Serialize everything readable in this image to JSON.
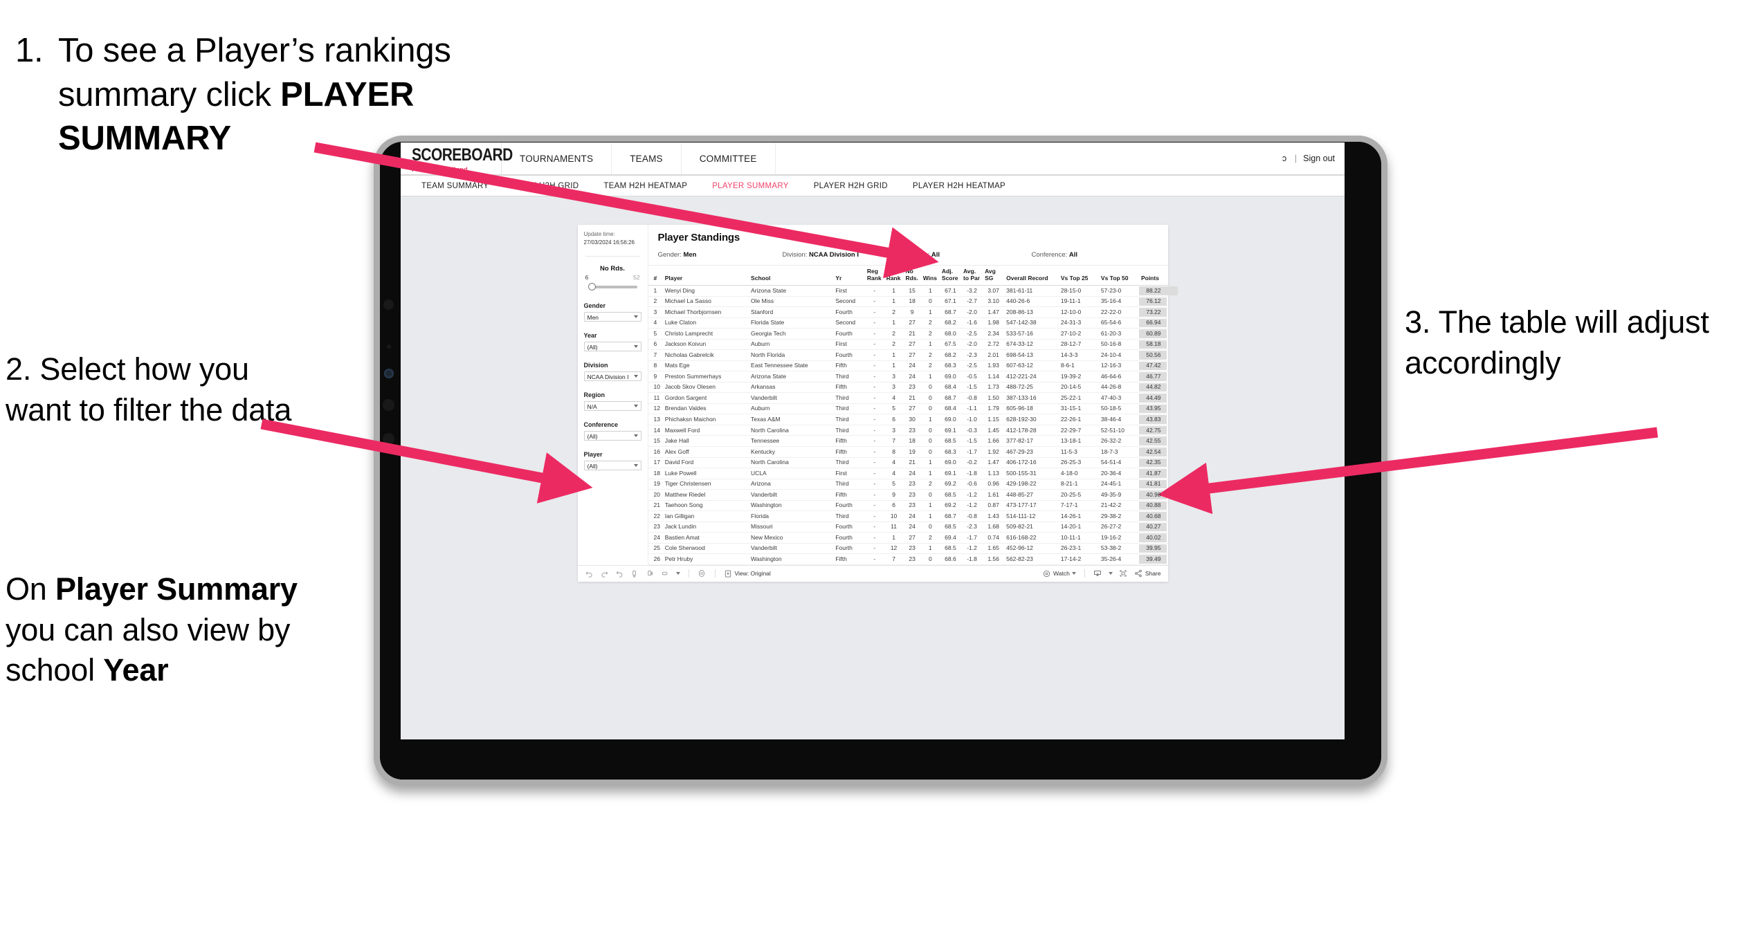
{
  "annotations": {
    "step1_num": "1.",
    "step1_a": "To see a Player’s rankings",
    "step1_b_pre": "summary click ",
    "step1_b_bold": "PLAYER",
    "step1_c_bold": "SUMMARY",
    "step2": "2. Select how you want to filter the data",
    "step2b_pre": "On ",
    "step2b_bold1": "Player Summary",
    "step2b_mid": " you can also view by school ",
    "step2b_bold2": "Year",
    "step3": "3. The table will adjust accordingly"
  },
  "app": {
    "brand_title": "SCOREBOARD",
    "brand_sub_pre": "Powered by ",
    "brand_sub_name": "clippd",
    "top_nav": [
      "TOURNAMENTS",
      "TEAMS",
      "COMMITTEE"
    ],
    "user_clipped": "ɔ",
    "separator": "|",
    "sign_out": "Sign out",
    "tabs": [
      {
        "label": "TEAM SUMMARY",
        "active": false
      },
      {
        "label": "TEAM H2H GRID",
        "active": false
      },
      {
        "label": "TEAM H2H HEATMAP",
        "active": false
      },
      {
        "label": "PLAYER SUMMARY",
        "active": true
      },
      {
        "label": "PLAYER H2H GRID",
        "active": false
      },
      {
        "label": "PLAYER H2H HEATMAP",
        "active": false
      }
    ],
    "accent_color": "#f0436b"
  },
  "viz": {
    "update_label": "Update time:",
    "update_time": "27/03/2024 16:56:26",
    "no_rds_label": "No Rds.",
    "slider_min": "6",
    "slider_max": "52",
    "filters": [
      {
        "label": "Gender",
        "value": "Men"
      },
      {
        "label": "Year",
        "value": "(All)"
      },
      {
        "label": "Division",
        "value": "NCAA Division I"
      },
      {
        "label": "Region",
        "value": "N/A"
      },
      {
        "label": "Conference",
        "value": "(All)"
      },
      {
        "label": "Player",
        "value": "(All)"
      }
    ],
    "title": "Player Standings",
    "meta": [
      {
        "label": "Gender:",
        "value": "Men"
      },
      {
        "label": "Division:",
        "value": "NCAA Division I"
      },
      {
        "label": "Region:",
        "value": "All"
      },
      {
        "label": "Conference:",
        "value": "All"
      }
    ],
    "toolbar": {
      "view_label": "View: Original",
      "watch_label": "Watch",
      "share_label": "Share"
    }
  },
  "table": {
    "headers": {
      "num": "#",
      "player": "Player",
      "school": "School",
      "yr": "Yr",
      "reg_rank": "Reg Rank",
      "conf_rank": "Conf Rank",
      "no_rds": "No Rds.",
      "wins": "Wins",
      "adj_score": "Adj. Score",
      "avg_to_par": "Avg. to Par",
      "avg_sg": "Avg SG",
      "overall_record": "Overall Record",
      "vs_top25": "Vs Top 25",
      "vs_top50": "Vs Top 50",
      "points": "Points"
    },
    "rows": [
      {
        "num": "1",
        "player": "Wenyi Ding",
        "school": "Arizona State",
        "yr": "First",
        "reg": "-",
        "conf": "1",
        "rds": "15",
        "wins": "1",
        "adj": "67.1",
        "atp": "-3.2",
        "sg": "3.07",
        "rec": "381-61-11",
        "t25": "28-15-0",
        "t50": "57-23-0",
        "pts": "88.22"
      },
      {
        "num": "2",
        "player": "Michael La Sasso",
        "school": "Ole Miss",
        "yr": "Second",
        "reg": "-",
        "conf": "1",
        "rds": "18",
        "wins": "0",
        "adj": "67.1",
        "atp": "-2.7",
        "sg": "3.10",
        "rec": "440-26-6",
        "t25": "19-11-1",
        "t50": "35-16-4",
        "pts": "76.12"
      },
      {
        "num": "3",
        "player": "Michael Thorbjornsen",
        "school": "Stanford",
        "yr": "Fourth",
        "reg": "-",
        "conf": "2",
        "rds": "9",
        "wins": "1",
        "adj": "68.7",
        "atp": "-2.0",
        "sg": "1.47",
        "rec": "208-86-13",
        "t25": "12-10-0",
        "t50": "22-22-0",
        "pts": "73.22"
      },
      {
        "num": "4",
        "player": "Luke Claton",
        "school": "Florida State",
        "yr": "Second",
        "reg": "-",
        "conf": "1",
        "rds": "27",
        "wins": "2",
        "adj": "68.2",
        "atp": "-1.6",
        "sg": "1.98",
        "rec": "547-142-38",
        "t25": "24-31-3",
        "t50": "65-54-6",
        "pts": "66.94"
      },
      {
        "num": "5",
        "player": "Christo Lamprecht",
        "school": "Georgia Tech",
        "yr": "Fourth",
        "reg": "-",
        "conf": "2",
        "rds": "21",
        "wins": "2",
        "adj": "68.0",
        "atp": "-2.5",
        "sg": "2.34",
        "rec": "533-57-16",
        "t25": "27-10-2",
        "t50": "61-20-3",
        "pts": "60.89"
      },
      {
        "num": "6",
        "player": "Jackson Koivun",
        "school": "Auburn",
        "yr": "First",
        "reg": "-",
        "conf": "2",
        "rds": "27",
        "wins": "1",
        "adj": "67.5",
        "atp": "-2.0",
        "sg": "2.72",
        "rec": "674-33-12",
        "t25": "28-12-7",
        "t50": "50-16-8",
        "pts": "58.18"
      },
      {
        "num": "7",
        "player": "Nicholas Gabrelcik",
        "school": "North Florida",
        "yr": "Fourth",
        "reg": "-",
        "conf": "1",
        "rds": "27",
        "wins": "2",
        "adj": "68.2",
        "atp": "-2.3",
        "sg": "2.01",
        "rec": "698-54-13",
        "t25": "14-3-3",
        "t50": "24-10-4",
        "pts": "50.56"
      },
      {
        "num": "8",
        "player": "Mats Ege",
        "school": "East Tennessee State",
        "yr": "Fifth",
        "reg": "-",
        "conf": "1",
        "rds": "24",
        "wins": "2",
        "adj": "68.3",
        "atp": "-2.5",
        "sg": "1.93",
        "rec": "607-63-12",
        "t25": "8-6-1",
        "t50": "12-16-3",
        "pts": "47.42"
      },
      {
        "num": "9",
        "player": "Preston Summerhays",
        "school": "Arizona State",
        "yr": "Third",
        "reg": "-",
        "conf": "3",
        "rds": "24",
        "wins": "1",
        "adj": "69.0",
        "atp": "-0.5",
        "sg": "1.14",
        "rec": "412-221-24",
        "t25": "19-39-2",
        "t50": "46-64-6",
        "pts": "46.77"
      },
      {
        "num": "10",
        "player": "Jacob Skov Olesen",
        "school": "Arkansas",
        "yr": "Fifth",
        "reg": "-",
        "conf": "3",
        "rds": "23",
        "wins": "0",
        "adj": "68.4",
        "atp": "-1.5",
        "sg": "1.73",
        "rec": "488-72-25",
        "t25": "20-14-5",
        "t50": "44-26-8",
        "pts": "44.82"
      },
      {
        "num": "11",
        "player": "Gordon Sargent",
        "school": "Vanderbilt",
        "yr": "Third",
        "reg": "-",
        "conf": "4",
        "rds": "21",
        "wins": "0",
        "adj": "68.7",
        "atp": "-0.8",
        "sg": "1.50",
        "rec": "387-133-16",
        "t25": "25-22-1",
        "t50": "47-40-3",
        "pts": "44.49"
      },
      {
        "num": "12",
        "player": "Brendan Valdes",
        "school": "Auburn",
        "yr": "Third",
        "reg": "-",
        "conf": "5",
        "rds": "27",
        "wins": "0",
        "adj": "68.4",
        "atp": "-1.1",
        "sg": "1.79",
        "rec": "605-96-18",
        "t25": "31-15-1",
        "t50": "50-18-5",
        "pts": "43.95"
      },
      {
        "num": "13",
        "player": "Phichaksn Maichon",
        "school": "Texas A&M",
        "yr": "Third",
        "reg": "-",
        "conf": "6",
        "rds": "30",
        "wins": "1",
        "adj": "69.0",
        "atp": "-1.0",
        "sg": "1.15",
        "rec": "628-192-30",
        "t25": "22-26-1",
        "t50": "38-46-4",
        "pts": "43.83"
      },
      {
        "num": "14",
        "player": "Maxwell Ford",
        "school": "North Carolina",
        "yr": "Third",
        "reg": "-",
        "conf": "3",
        "rds": "23",
        "wins": "0",
        "adj": "69.1",
        "atp": "-0.3",
        "sg": "1.45",
        "rec": "412-178-28",
        "t25": "22-29-7",
        "t50": "52-51-10",
        "pts": "42.75"
      },
      {
        "num": "15",
        "player": "Jake Hall",
        "school": "Tennessee",
        "yr": "Fifth",
        "reg": "-",
        "conf": "7",
        "rds": "18",
        "wins": "0",
        "adj": "68.5",
        "atp": "-1.5",
        "sg": "1.66",
        "rec": "377-82-17",
        "t25": "13-18-1",
        "t50": "26-32-2",
        "pts": "42.55"
      },
      {
        "num": "16",
        "player": "Alex Goff",
        "school": "Kentucky",
        "yr": "Fifth",
        "reg": "-",
        "conf": "8",
        "rds": "19",
        "wins": "0",
        "adj": "68.3",
        "atp": "-1.7",
        "sg": "1.92",
        "rec": "467-29-23",
        "t25": "11-5-3",
        "t50": "18-7-3",
        "pts": "42.54"
      },
      {
        "num": "17",
        "player": "David Ford",
        "school": "North Carolina",
        "yr": "Third",
        "reg": "-",
        "conf": "4",
        "rds": "21",
        "wins": "1",
        "adj": "69.0",
        "atp": "-0.2",
        "sg": "1.47",
        "rec": "406-172-16",
        "t25": "26-25-3",
        "t50": "54-51-4",
        "pts": "42.35"
      },
      {
        "num": "18",
        "player": "Luke Powell",
        "school": "UCLA",
        "yr": "First",
        "reg": "-",
        "conf": "4",
        "rds": "24",
        "wins": "1",
        "adj": "69.1",
        "atp": "-1.8",
        "sg": "1.13",
        "rec": "500-155-31",
        "t25": "4-18-0",
        "t50": "20-36-4",
        "pts": "41.87"
      },
      {
        "num": "19",
        "player": "Tiger Christensen",
        "school": "Arizona",
        "yr": "Third",
        "reg": "-",
        "conf": "5",
        "rds": "23",
        "wins": "2",
        "adj": "69.2",
        "atp": "-0.6",
        "sg": "0.96",
        "rec": "429-198-22",
        "t25": "8-21-1",
        "t50": "24-45-1",
        "pts": "41.81"
      },
      {
        "num": "20",
        "player": "Matthew Riedel",
        "school": "Vanderbilt",
        "yr": "Fifth",
        "reg": "-",
        "conf": "9",
        "rds": "23",
        "wins": "0",
        "adj": "68.5",
        "atp": "-1.2",
        "sg": "1.61",
        "rec": "448-85-27",
        "t25": "20-25-5",
        "t50": "49-35-9",
        "pts": "40.98"
      },
      {
        "num": "21",
        "player": "Taehoon Song",
        "school": "Washington",
        "yr": "Fourth",
        "reg": "-",
        "conf": "6",
        "rds": "23",
        "wins": "1",
        "adj": "69.2",
        "atp": "-1.2",
        "sg": "0.87",
        "rec": "473-177-17",
        "t25": "7-17-1",
        "t50": "21-42-2",
        "pts": "40.88"
      },
      {
        "num": "22",
        "player": "Ian Gilligan",
        "school": "Florida",
        "yr": "Third",
        "reg": "-",
        "conf": "10",
        "rds": "24",
        "wins": "1",
        "adj": "68.7",
        "atp": "-0.8",
        "sg": "1.43",
        "rec": "514-111-12",
        "t25": "14-26-1",
        "t50": "29-38-2",
        "pts": "40.68"
      },
      {
        "num": "23",
        "player": "Jack Lundin",
        "school": "Missouri",
        "yr": "Fourth",
        "reg": "-",
        "conf": "11",
        "rds": "24",
        "wins": "0",
        "adj": "68.5",
        "atp": "-2.3",
        "sg": "1.68",
        "rec": "509-82-21",
        "t25": "14-20-1",
        "t50": "26-27-2",
        "pts": "40.27"
      },
      {
        "num": "24",
        "player": "Bastien Amat",
        "school": "New Mexico",
        "yr": "Fourth",
        "reg": "-",
        "conf": "1",
        "rds": "27",
        "wins": "2",
        "adj": "69.4",
        "atp": "-1.7",
        "sg": "0.74",
        "rec": "616-168-22",
        "t25": "10-11-1",
        "t50": "19-16-2",
        "pts": "40.02"
      },
      {
        "num": "25",
        "player": "Cole Sherwood",
        "school": "Vanderbilt",
        "yr": "Fourth",
        "reg": "-",
        "conf": "12",
        "rds": "23",
        "wins": "1",
        "adj": "68.5",
        "atp": "-1.2",
        "sg": "1.65",
        "rec": "452-96-12",
        "t25": "26-23-1",
        "t50": "53-38-2",
        "pts": "39.95"
      },
      {
        "num": "26",
        "player": "Petr Hruby",
        "school": "Washington",
        "yr": "Fifth",
        "reg": "-",
        "conf": "7",
        "rds": "23",
        "wins": "0",
        "adj": "68.6",
        "atp": "-1.8",
        "sg": "1.56",
        "rec": "562-82-23",
        "t25": "17-14-2",
        "t50": "35-26-4",
        "pts": "39.49"
      }
    ]
  }
}
